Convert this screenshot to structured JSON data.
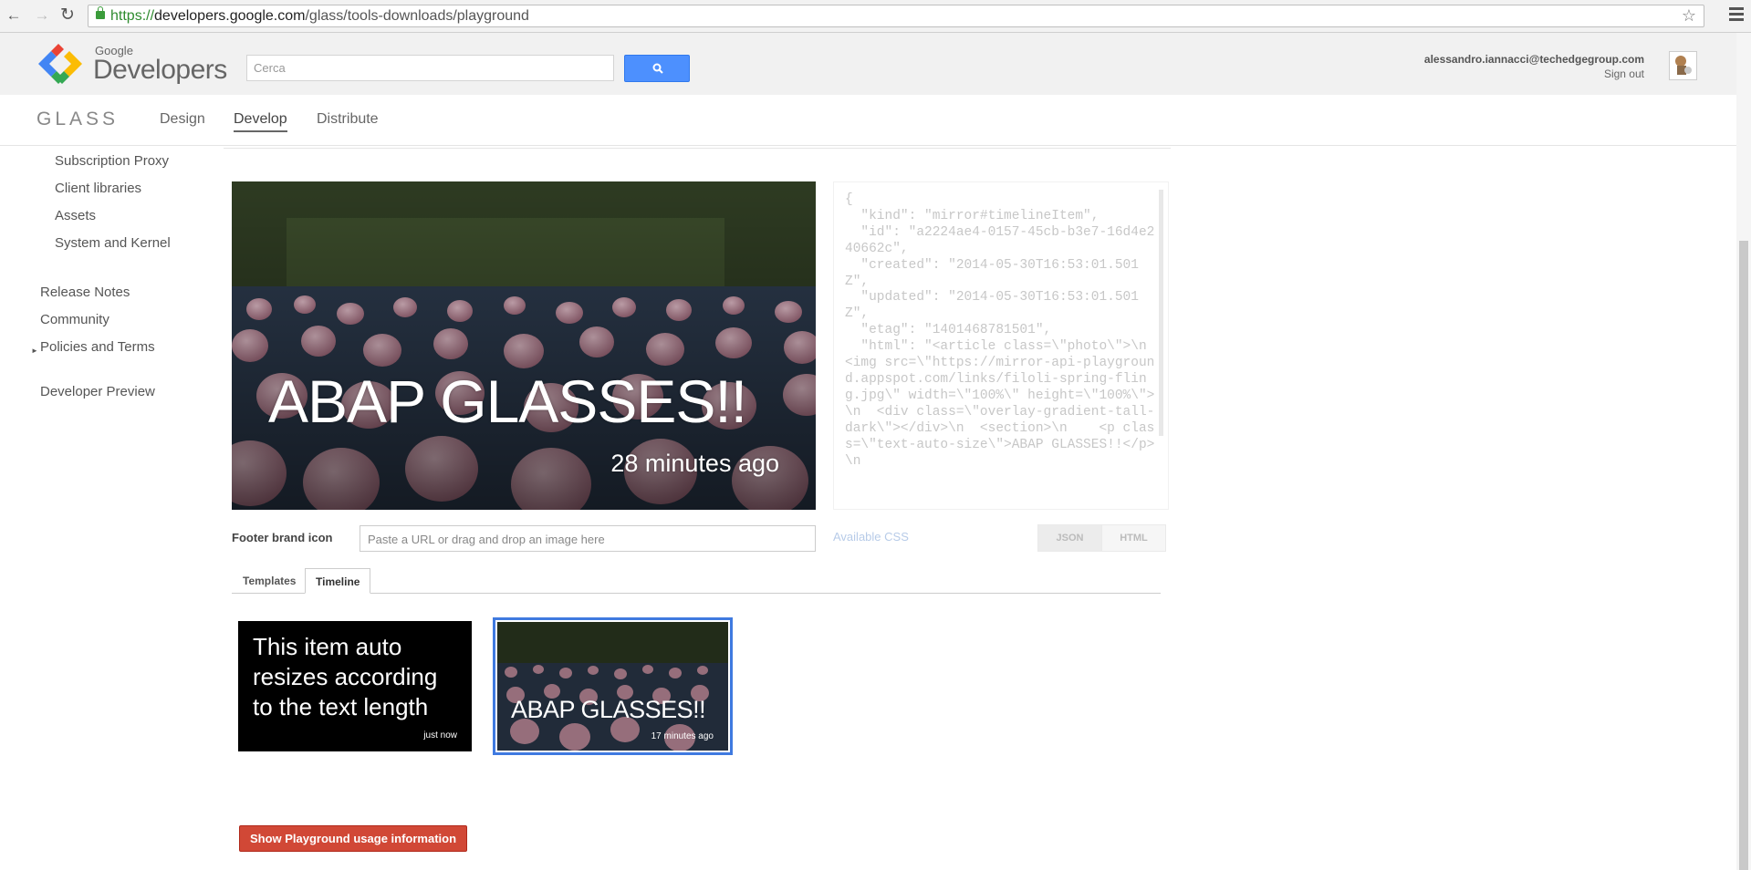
{
  "browser": {
    "url_scheme": "https://",
    "url_host": "developers.google.com",
    "url_path": "/glass/tools-downloads/playground"
  },
  "header": {
    "logo_small": "Google",
    "logo_big": "Developers",
    "search_placeholder": "Cerca",
    "user_email": "alessandro.iannacci@techedgegroup.com",
    "sign_out": "Sign out"
  },
  "nav": {
    "product": "GLASS",
    "items": [
      "Design",
      "Develop",
      "Distribute"
    ],
    "active": "Develop"
  },
  "sidebar": {
    "sub_items": [
      "Subscription Proxy",
      "Client libraries",
      "Assets",
      "System and Kernel"
    ],
    "items": [
      "Release Notes",
      "Community",
      "Policies and Terms",
      "Developer Preview"
    ]
  },
  "card": {
    "title": "ABAP GLASSES!!",
    "time": "28 minutes ago"
  },
  "json_text": "{\n  \"kind\": \"mirror#timelineItem\",\n  \"id\": \"a2224ae4-0157-45cb-b3e7-16d4e240662c\",\n  \"created\": \"2014-05-30T16:53:01.501Z\",\n  \"updated\": \"2014-05-30T16:53:01.501Z\",\n  \"etag\": \"1401468781501\",\n  \"html\": \"<article class=\\\"photo\\\">\\n  <img src=\\\"https://mirror-api-playground.appspot.com/links/filoli-spring-fling.jpg\\\" width=\\\"100%\\\" height=\\\"100%\\\">\\n  <div class=\\\"overlay-gradient-tall-dark\\\"></div>\\n  <section>\\n    <p class=\\\"text-auto-size\\\">ABAP GLASSES!!</p>\\n",
  "footer": {
    "label": "Footer brand icon",
    "placeholder": "Paste a URL or drag and drop an image here",
    "available_css": "Available CSS",
    "json_btn": "JSON",
    "html_btn": "HTML"
  },
  "tabs": {
    "templates": "Templates",
    "timeline": "Timeline",
    "active": "Timeline"
  },
  "timeline": [
    {
      "text": "This item auto resizes according to the text length",
      "time": "just now"
    },
    {
      "text": "ABAP GLASSES!!",
      "time": "17 minutes ago"
    }
  ],
  "playground_button": "Show Playground usage information",
  "colors": {
    "search_blue": "#4d90fe",
    "selection_blue": "#3f7ae0",
    "red_button": "#d14836"
  }
}
